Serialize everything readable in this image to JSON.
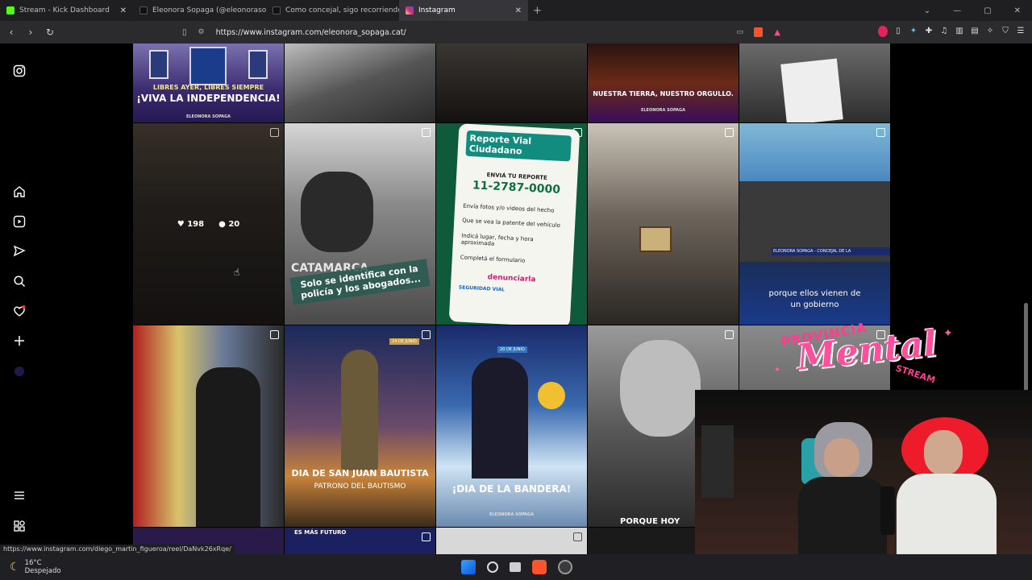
{
  "tabs": [
    {
      "label": "Stream - Kick Dashboard",
      "color": "#53fc18"
    },
    {
      "label": "Eleonora Sopaga (@eleonorasopaga",
      "color": "#111111"
    },
    {
      "label": "Como concejal, sigo recorriendo l",
      "color": "#111111"
    },
    {
      "label": "Instagram",
      "color": "#d6249f",
      "active": true
    }
  ],
  "address": {
    "url": "https://www.instagram.com/eleonora_sopaga.cat/"
  },
  "posts": [
    {
      "caption_top": "LIBRES AYER, LIBRES SIEMPRE",
      "caption": "¡VIVA LA INDEPENDENCIA!",
      "brand": "ELEONORA SOPAGA"
    },
    {
      "caption": ""
    },
    {
      "caption": ""
    },
    {
      "caption": "NUESTRA TIERRA, NUESTRO ORGULLO.",
      "brand": "ELEONORA SOPAGA"
    },
    {
      "caption": ""
    },
    {
      "likes": "198",
      "comments": "20"
    },
    {
      "caption": "Solo se identifica con la policía y los abogados...",
      "tag": "CATAMARCA"
    },
    {
      "title": "Reporte Vial Ciudadano",
      "sub": "ENVIÁ TU REPORTE",
      "phone": "11-2787-0000",
      "lines": [
        "Envía fotos y/o videos del hecho",
        "Que se vea la patente del vehículo",
        "Indicá lugar, fecha y hora aproximada",
        "Completá el formulario"
      ],
      "footer": "denunciarla",
      "org": "SEGURIDAD VIAL"
    },
    {
      "caption": ""
    },
    {
      "caption": "porque ellos vienen de un gobierno",
      "lower": "ELEONORA SOPAGA - CONCEJAL DE LA"
    },
    {
      "caption": ""
    },
    {
      "caption": "DIA DE SAN JUAN BAUTISTA",
      "sub": "PATRONO DEL BAUTISMO",
      "date": "24 DE JUNIO"
    },
    {
      "caption": "¡DIA DE LA BANDERA!",
      "date": "20 DE JUNIO",
      "brand": "ELEONORA SOPAGA"
    },
    {
      "caption": "PORQUE HOY"
    },
    {
      "caption": "ES MÁS FUTURO"
    }
  ],
  "overlay": {
    "logo_top": "Provincia",
    "logo_main": "Mental",
    "logo_bottom": "STREAM"
  },
  "status_url": "https://www.instagram.com/diego_martin_figueroa/reel/DaNvk26xRqe/",
  "weather": {
    "temp": "16°C",
    "desc": "Despejado"
  }
}
